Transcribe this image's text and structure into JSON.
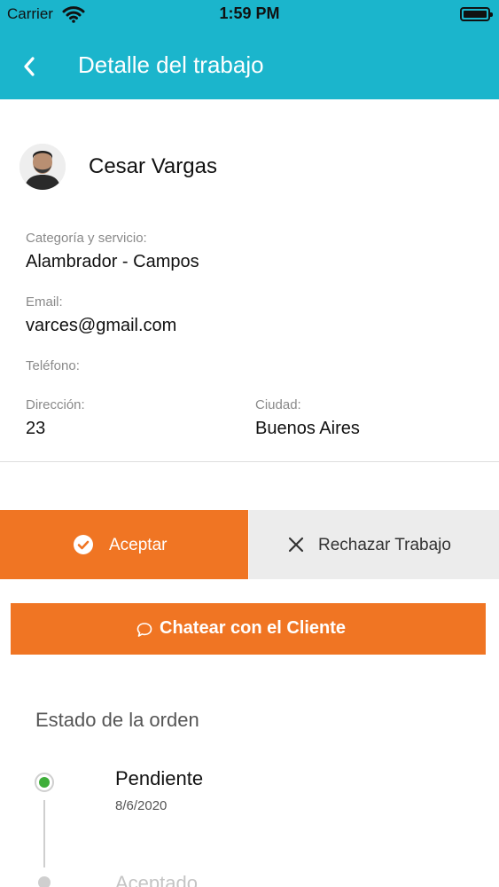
{
  "status_bar": {
    "carrier": "Carrier",
    "time": "1:59 PM"
  },
  "header": {
    "title": "Detalle del trabajo",
    "back_icon": "chevron-left-icon"
  },
  "colors": {
    "header": "#1bb5cc",
    "accent": "#f07523",
    "status_done": "#3fae3a"
  },
  "user": {
    "name": "Cesar Vargas"
  },
  "details": {
    "category_label": "Categoría y servicio:",
    "category_value": "Alambrador - Campos",
    "email_label": "Email:",
    "email_value": "varces@gmail.com",
    "phone_label": "Teléfono:",
    "address_label": "Dirección:",
    "address_value": "23",
    "city_label": "Ciudad:",
    "city_value": "Buenos Aires"
  },
  "actions": {
    "accept_label": "Aceptar",
    "accept_icon": "check-circle-icon",
    "reject_label": "Rechazar Trabajo",
    "reject_icon": "close-icon",
    "chat_label": "Chatear con el Cliente",
    "chat_icon": "chat-bubble-icon"
  },
  "order_status": {
    "title": "Estado de la orden",
    "steps": [
      {
        "label": "Pendiente",
        "date": "8/6/2020",
        "active": true
      },
      {
        "label": "Aceptado",
        "active": false
      }
    ]
  }
}
